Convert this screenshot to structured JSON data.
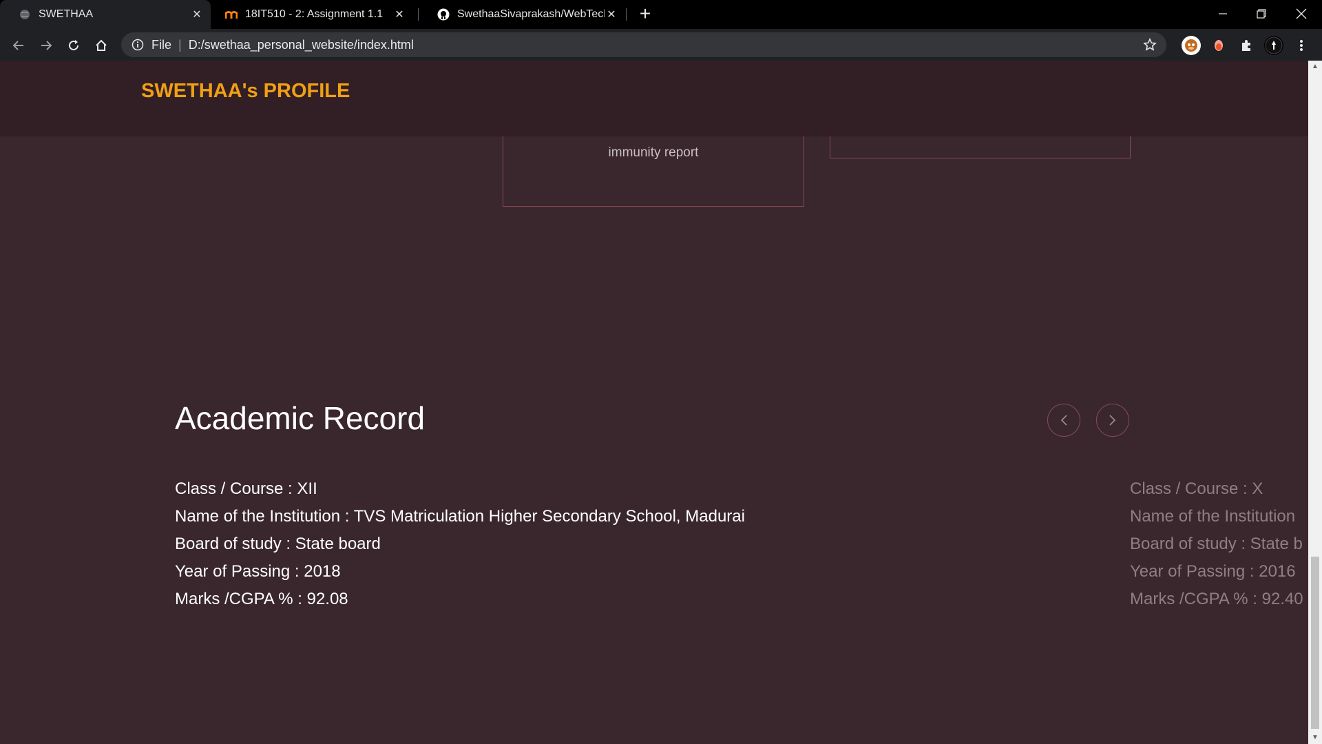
{
  "browser": {
    "tabs": [
      {
        "title": "SWETHAA",
        "icon": "globe-icon",
        "active": true
      },
      {
        "title": "18IT510 - 2: Assignment 1.1",
        "icon": "moodle-icon",
        "active": false
      },
      {
        "title": "SwethaaSivaprakash/WebTechnol",
        "icon": "github-icon",
        "active": false
      }
    ],
    "new_tab_label": "+",
    "address": {
      "scheme": "File",
      "url": "D:/swethaa_personal_website/index.html"
    }
  },
  "page": {
    "brand": "SWETHAA's PROFILE",
    "cards": [
      {
        "text": "immunity report"
      }
    ],
    "academic": {
      "title": "Academic Record",
      "records": [
        {
          "class": "Class / Course : XII",
          "institution": "Name of the Institution : TVS Matriculation Higher Secondary School, Madurai",
          "board": "Board of study : State board",
          "year": "Year of Passing : 2018",
          "marks": "Marks /CGPA % : 92.08"
        },
        {
          "class": "Class / Course : X",
          "institution": "Name of the Institution",
          "board": "Board of study : State b",
          "year": "Year of Passing : 2016",
          "marks": "Marks /CGPA % : 92.40"
        }
      ]
    }
  },
  "colors": {
    "background": "#3a272d",
    "header": "#321f25",
    "brand": "#f0a014",
    "accent_border": "#8a4b55"
  }
}
